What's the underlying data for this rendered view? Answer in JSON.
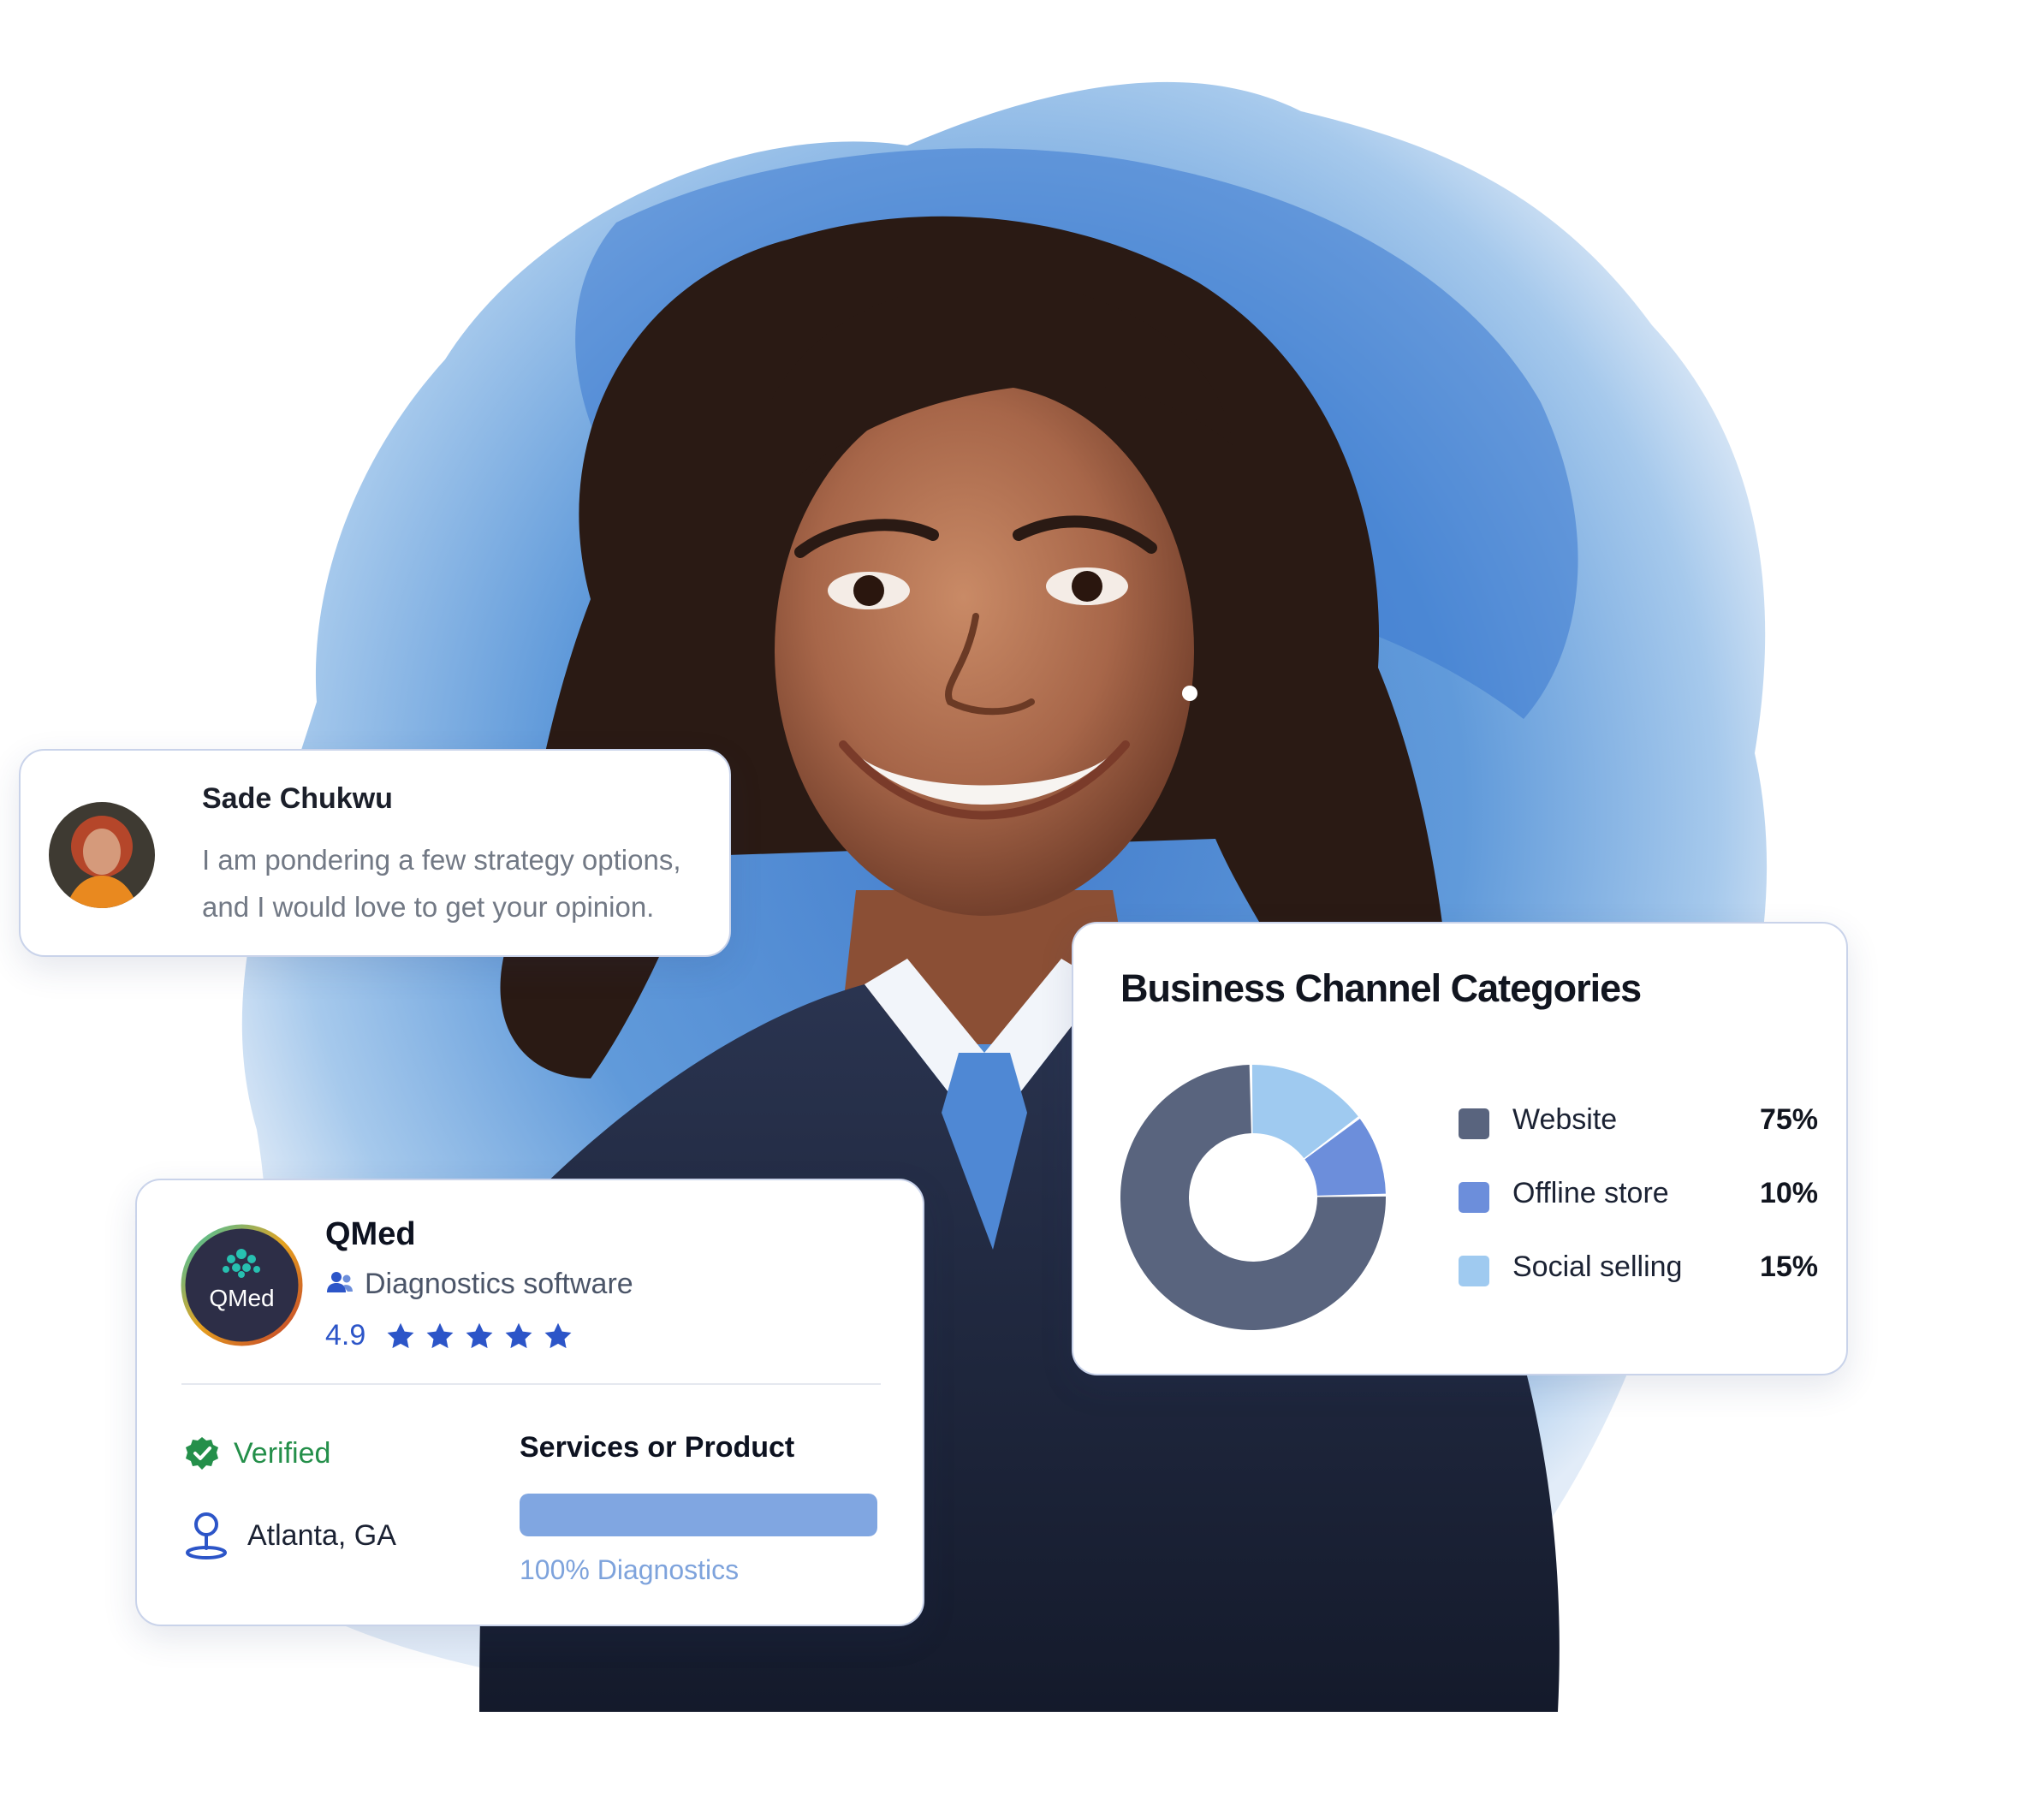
{
  "message_card": {
    "name": "Sade Chukwu",
    "text_line1": "I am pondering a few strategy options,",
    "text_line2": "and I would love to  get your opinion."
  },
  "chart_card": {
    "chart_data": {
      "type": "pie",
      "title": "Business Channel Categories",
      "donut": true,
      "legend_position": "right",
      "categories": [
        "Website",
        "Offline store",
        "Social selling"
      ],
      "values": [
        75,
        10,
        15
      ],
      "value_labels": [
        "75%",
        "10%",
        "15%"
      ],
      "colors": [
        "#59647e",
        "#6c8edb",
        "#9fcaf0"
      ]
    }
  },
  "company_card": {
    "name": "QMed",
    "logo_text": "QMed",
    "category": "Diagnostics software",
    "rating": "4.9",
    "stars": 5,
    "verified_label": "Verified",
    "location": "Atlanta, GA",
    "services_title": "Services or Product",
    "services_progress": 1.0,
    "services_caption": "100% Diagnostics",
    "colors": {
      "accent_blue": "#2c55c8",
      "verified_green": "#248f4a",
      "progress_fill": "#80a6e1"
    }
  }
}
